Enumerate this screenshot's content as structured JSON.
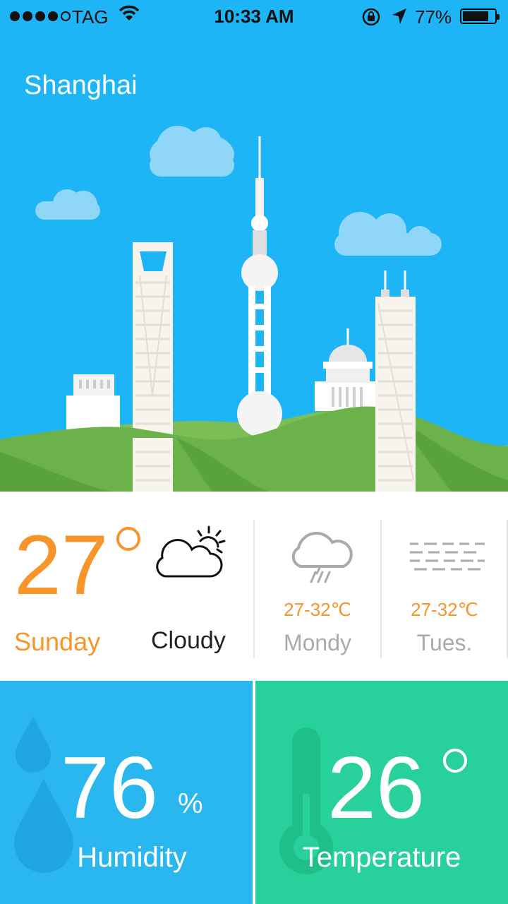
{
  "status_bar": {
    "carrier": "TAG",
    "time": "10:33 AM",
    "battery": "77%",
    "icons": [
      "signal-dots-icon",
      "wifi-icon",
      "rotation-lock-icon",
      "location-arrow-icon",
      "battery-icon"
    ]
  },
  "hero": {
    "city": "Shanghai"
  },
  "today": {
    "temperature": "27",
    "day": "Sunday",
    "condition": "Cloudy",
    "icon": "cloudy-sun-icon"
  },
  "forecast": [
    {
      "range": "27-32℃",
      "day": "Mondy",
      "icon": "rain-icon"
    },
    {
      "range": "27-32℃",
      "day": "Tues.",
      "icon": "fog-icon"
    }
  ],
  "humidity": {
    "value": "76",
    "unit": "%",
    "label": "Humidity",
    "icon": "water-drop-icon"
  },
  "temperature": {
    "value": "26",
    "label": "Temperature",
    "icon": "thermometer-icon"
  },
  "colors": {
    "sky": "#1db5f5",
    "accent_orange": "#f7952a",
    "humidity_panel": "#2ab6ee",
    "temperature_panel": "#28d19c",
    "hills": "#6bb24a"
  }
}
